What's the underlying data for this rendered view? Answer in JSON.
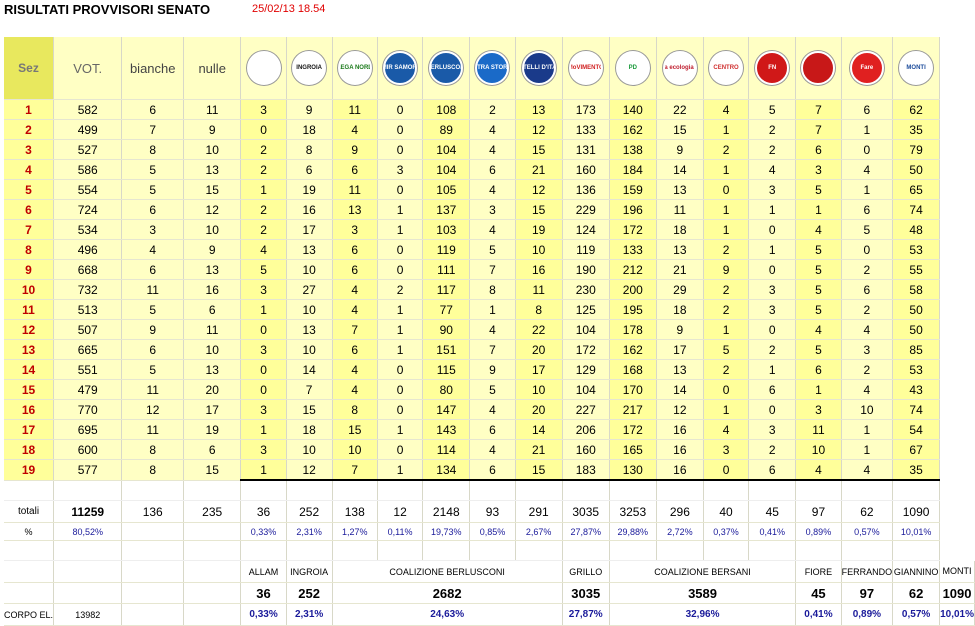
{
  "title": "RISULTATI PROVVISORI SENATO",
  "timestamp": "25/02/13 18.54",
  "headers": {
    "sez": "Sez",
    "vot": "VOT.",
    "bianche": "bianche",
    "nulle": "nulle"
  },
  "logos": [
    {
      "name": "allam-logo-icon",
      "text": "",
      "bg": "#ffffff",
      "fg": "#2a8a2a"
    },
    {
      "name": "ingroia-logo-icon",
      "text": "INGROIA",
      "bg": "#ffffff",
      "fg": "#111111"
    },
    {
      "name": "lega-nord-logo-icon",
      "text": "LEGA NORD",
      "bg": "#ffffff",
      "fg": "#1a7a1a"
    },
    {
      "name": "mir-logo-icon",
      "text": "MIR SAMORI",
      "bg": "#1a5aa8",
      "fg": "#ffffff"
    },
    {
      "name": "pdl-logo-icon",
      "text": "BERLUSCONI",
      "bg": "#1a5aa8",
      "fg": "#ffffff"
    },
    {
      "name": "la-destra-logo-icon",
      "text": "DESTRA STORACE",
      "bg": "#1a6ac8",
      "fg": "#ffffff"
    },
    {
      "name": "fratelli-italia-logo-icon",
      "text": "FRATELLI D'ITALIA",
      "bg": "#1a3a8a",
      "fg": "#ffffff"
    },
    {
      "name": "m5s-logo-icon",
      "text": "MoVIMENTO",
      "bg": "#ffffff",
      "fg": "#d02020"
    },
    {
      "name": "pd-logo-icon",
      "text": "PD",
      "bg": "#ffffff",
      "fg": "#1a9a3a"
    },
    {
      "name": "sel-logo-icon",
      "text": "sinistra ecologia libertà",
      "bg": "#ffffff",
      "fg": "#c02030"
    },
    {
      "name": "centro-democratico-logo-icon",
      "text": "CENTRO",
      "bg": "#ffffff",
      "fg": "#d03030"
    },
    {
      "name": "forza-nuova-logo-icon",
      "text": "FN",
      "bg": "#d01818",
      "fg": "#ffffff"
    },
    {
      "name": "ferrando-logo-icon",
      "text": "",
      "bg": "#c81818",
      "fg": "#ffffff"
    },
    {
      "name": "fare-logo-icon",
      "text": "Fare",
      "bg": "#e02020",
      "fg": "#ffffff"
    },
    {
      "name": "monti-logo-icon",
      "text": "MONTI",
      "bg": "#ffffff",
      "fg": "#1a4a9a"
    }
  ],
  "rows": [
    {
      "sez": "1",
      "vot": "582",
      "bianche": "6",
      "nulle": "11",
      "v": [
        "3",
        "9",
        "11",
        "0",
        "108",
        "2",
        "13",
        "173",
        "140",
        "22",
        "4",
        "5",
        "7",
        "6",
        "62"
      ]
    },
    {
      "sez": "2",
      "vot": "499",
      "bianche": "7",
      "nulle": "9",
      "v": [
        "0",
        "18",
        "4",
        "0",
        "89",
        "4",
        "12",
        "133",
        "162",
        "15",
        "1",
        "2",
        "7",
        "1",
        "35"
      ]
    },
    {
      "sez": "3",
      "vot": "527",
      "bianche": "8",
      "nulle": "10",
      "v": [
        "2",
        "8",
        "9",
        "0",
        "104",
        "4",
        "15",
        "131",
        "138",
        "9",
        "2",
        "2",
        "6",
        "0",
        "79"
      ]
    },
    {
      "sez": "4",
      "vot": "586",
      "bianche": "5",
      "nulle": "13",
      "v": [
        "2",
        "6",
        "6",
        "3",
        "104",
        "6",
        "21",
        "160",
        "184",
        "14",
        "1",
        "4",
        "3",
        "4",
        "50"
      ]
    },
    {
      "sez": "5",
      "vot": "554",
      "bianche": "5",
      "nulle": "15",
      "v": [
        "1",
        "19",
        "11",
        "0",
        "105",
        "4",
        "12",
        "136",
        "159",
        "13",
        "0",
        "3",
        "5",
        "1",
        "65"
      ]
    },
    {
      "sez": "6",
      "vot": "724",
      "bianche": "6",
      "nulle": "12",
      "v": [
        "2",
        "16",
        "13",
        "1",
        "137",
        "3",
        "15",
        "229",
        "196",
        "11",
        "1",
        "1",
        "1",
        "6",
        "74"
      ]
    },
    {
      "sez": "7",
      "vot": "534",
      "bianche": "3",
      "nulle": "10",
      "v": [
        "2",
        "17",
        "3",
        "1",
        "103",
        "4",
        "19",
        "124",
        "172",
        "18",
        "1",
        "0",
        "4",
        "5",
        "48"
      ]
    },
    {
      "sez": "8",
      "vot": "496",
      "bianche": "4",
      "nulle": "9",
      "v": [
        "4",
        "13",
        "6",
        "0",
        "119",
        "5",
        "10",
        "119",
        "133",
        "13",
        "2",
        "1",
        "5",
        "0",
        "53"
      ]
    },
    {
      "sez": "9",
      "vot": "668",
      "bianche": "6",
      "nulle": "13",
      "v": [
        "5",
        "10",
        "6",
        "0",
        "111",
        "7",
        "16",
        "190",
        "212",
        "21",
        "9",
        "0",
        "5",
        "2",
        "55"
      ]
    },
    {
      "sez": "10",
      "vot": "732",
      "bianche": "11",
      "nulle": "16",
      "v": [
        "3",
        "27",
        "4",
        "2",
        "117",
        "8",
        "11",
        "230",
        "200",
        "29",
        "2",
        "3",
        "5",
        "6",
        "58"
      ]
    },
    {
      "sez": "11",
      "vot": "513",
      "bianche": "5",
      "nulle": "6",
      "v": [
        "1",
        "10",
        "4",
        "1",
        "77",
        "1",
        "8",
        "125",
        "195",
        "18",
        "2",
        "3",
        "5",
        "2",
        "50"
      ]
    },
    {
      "sez": "12",
      "vot": "507",
      "bianche": "9",
      "nulle": "11",
      "v": [
        "0",
        "13",
        "7",
        "1",
        "90",
        "4",
        "22",
        "104",
        "178",
        "9",
        "1",
        "0",
        "4",
        "4",
        "50"
      ]
    },
    {
      "sez": "13",
      "vot": "665",
      "bianche": "6",
      "nulle": "10",
      "v": [
        "3",
        "10",
        "6",
        "1",
        "151",
        "7",
        "20",
        "172",
        "162",
        "17",
        "5",
        "2",
        "5",
        "3",
        "85"
      ]
    },
    {
      "sez": "14",
      "vot": "551",
      "bianche": "5",
      "nulle": "13",
      "v": [
        "0",
        "14",
        "4",
        "0",
        "115",
        "9",
        "17",
        "129",
        "168",
        "13",
        "2",
        "1",
        "6",
        "2",
        "53"
      ]
    },
    {
      "sez": "15",
      "vot": "479",
      "bianche": "11",
      "nulle": "20",
      "v": [
        "0",
        "7",
        "4",
        "0",
        "80",
        "5",
        "10",
        "104",
        "170",
        "14",
        "0",
        "6",
        "1",
        "4",
        "43"
      ]
    },
    {
      "sez": "16",
      "vot": "770",
      "bianche": "12",
      "nulle": "17",
      "v": [
        "3",
        "15",
        "8",
        "0",
        "147",
        "4",
        "20",
        "227",
        "217",
        "12",
        "1",
        "0",
        "3",
        "10",
        "74"
      ]
    },
    {
      "sez": "17",
      "vot": "695",
      "bianche": "11",
      "nulle": "19",
      "v": [
        "1",
        "18",
        "15",
        "1",
        "143",
        "6",
        "14",
        "206",
        "172",
        "16",
        "4",
        "3",
        "11",
        "1",
        "54"
      ]
    },
    {
      "sez": "18",
      "vot": "600",
      "bianche": "8",
      "nulle": "6",
      "v": [
        "3",
        "10",
        "10",
        "0",
        "114",
        "4",
        "21",
        "160",
        "165",
        "16",
        "3",
        "2",
        "10",
        "1",
        "67"
      ]
    },
    {
      "sez": "19",
      "vot": "577",
      "bianche": "8",
      "nulle": "15",
      "v": [
        "1",
        "12",
        "7",
        "1",
        "134",
        "6",
        "15",
        "183",
        "130",
        "16",
        "0",
        "6",
        "4",
        "4",
        "35"
      ]
    }
  ],
  "totals": {
    "label": "totali",
    "vot": "11259",
    "bianche": "136",
    "nulle": "235",
    "v": [
      "36",
      "252",
      "138",
      "12",
      "2148",
      "93",
      "291",
      "3035",
      "3253",
      "296",
      "40",
      "45",
      "97",
      "62",
      "1090"
    ]
  },
  "percent": {
    "label": "%",
    "vot": "80,52%",
    "v": [
      "0,33%",
      "2,31%",
      "1,27%",
      "0,11%",
      "19,73%",
      "0,85%",
      "2,67%",
      "27,87%",
      "29,88%",
      "2,72%",
      "0,37%",
      "0,41%",
      "0,89%",
      "0,57%",
      "10,01%"
    ]
  },
  "summary": {
    "labels": [
      "ALLAM",
      "INGROIA",
      "COALIZIONE BERLUSCONI",
      "GRILLO",
      "COALIZIONE BERSANI",
      "FIORE",
      "FERRANDO",
      "GIANNINO",
      "MONTI"
    ],
    "values": [
      "36",
      "252",
      "2682",
      "3035",
      "3589",
      "45",
      "97",
      "62",
      "1090"
    ],
    "percents": [
      "0,33%",
      "2,31%",
      "24,63%",
      "27,87%",
      "32,96%",
      "0,41%",
      "0,89%",
      "0,57%",
      "10,01%"
    ],
    "corpo_label": "CORPO EL.",
    "corpo_value": "13982"
  }
}
